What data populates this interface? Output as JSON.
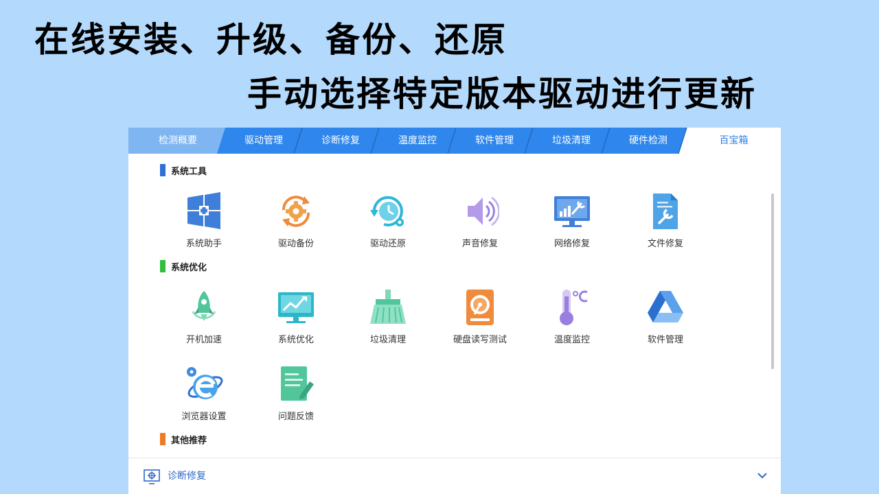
{
  "headline": {
    "line1": "在线安装、升级、备份、还原",
    "line2": "手动选择特定版本驱动进行更新"
  },
  "tabs": [
    {
      "label": "检测概要",
      "state": "first"
    },
    {
      "label": "驱动管理",
      "state": "normal"
    },
    {
      "label": "诊断修复",
      "state": "normal"
    },
    {
      "label": "温度监控",
      "state": "normal"
    },
    {
      "label": "软件管理",
      "state": "normal"
    },
    {
      "label": "垃圾清理",
      "state": "normal"
    },
    {
      "label": "硬件检测",
      "state": "normal"
    },
    {
      "label": "百宝箱",
      "state": "active"
    }
  ],
  "colors": {
    "tab_bar": "#2f86ec",
    "tab_first": "#7fb6f2",
    "tab_active_text": "#2f7fe0",
    "section_tools": "#2f6fd6",
    "section_optimize": "#2fbf3a",
    "section_other": "#f07a22"
  },
  "sections": {
    "tools": {
      "title": "系统工具",
      "items": [
        {
          "label": "系统助手",
          "icon": "windows-icon"
        },
        {
          "label": "驱动备份",
          "icon": "gear-sync-icon"
        },
        {
          "label": "驱动还原",
          "icon": "clock-restore-icon"
        },
        {
          "label": "声音修复",
          "icon": "speaker-icon"
        },
        {
          "label": "网络修复",
          "icon": "monitor-wrench-icon"
        },
        {
          "label": "文件修复",
          "icon": "file-wrench-icon"
        }
      ]
    },
    "optimize": {
      "title": "系统优化",
      "items": [
        {
          "label": "开机加速",
          "icon": "rocket-icon"
        },
        {
          "label": "系统优化",
          "icon": "monitor-chart-icon"
        },
        {
          "label": "垃圾清理",
          "icon": "broom-icon"
        },
        {
          "label": "硬盘读写测试",
          "icon": "hard-disk-icon"
        },
        {
          "label": "温度监控",
          "icon": "thermometer-icon"
        },
        {
          "label": "软件管理",
          "icon": "drive-triangle-icon"
        },
        {
          "label": "浏览器设置",
          "icon": "ie-browser-icon"
        },
        {
          "label": "问题反馈",
          "icon": "feedback-note-icon"
        }
      ]
    },
    "other": {
      "title": "其他推荐"
    }
  },
  "bottom": {
    "label": "诊断修复",
    "icon": "diagnose-icon",
    "chevron": "chevron-down-icon"
  }
}
